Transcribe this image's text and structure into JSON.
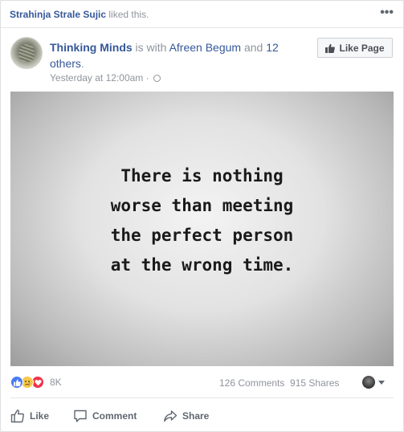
{
  "liked_by": {
    "name": "Strahinja Strale Sujic",
    "suffix": "liked this."
  },
  "more_label": "•••",
  "post": {
    "page_name": "Thinking Minds",
    "with_text": "is with",
    "tagged": "Afreen Begum",
    "and_text": "and",
    "others": "12 others",
    "period": ".",
    "timestamp": "Yesterday at 12:00am",
    "separator": "·",
    "like_page_label": "Like Page"
  },
  "image": {
    "lines": [
      "There is nothing",
      "worse than meeting",
      "the perfect person",
      "at the wrong time."
    ]
  },
  "summary": {
    "reaction_icons": [
      "like-icon",
      "sad-icon",
      "love-icon"
    ],
    "reaction_count": "8K",
    "comments": "126 Comments",
    "shares": "915 Shares"
  },
  "actions": {
    "like": "Like",
    "comment": "Comment",
    "share": "Share"
  },
  "colors": {
    "link": "#365899",
    "muted": "#90949c",
    "action": "#606770",
    "like_reaction": "#4a7bf0",
    "love_reaction": "#f0344c",
    "sad_reaction": "#f7c74a"
  }
}
